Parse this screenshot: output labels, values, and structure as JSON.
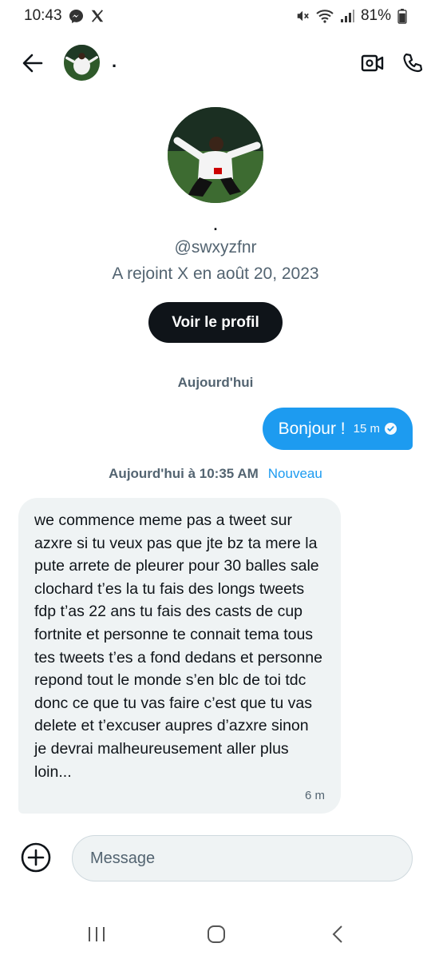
{
  "status_bar": {
    "time": "10:43",
    "battery": "81%"
  },
  "header": {
    "name": "."
  },
  "profile": {
    "name": ".",
    "handle": "@swxyzfnr",
    "joined": "A rejoint X en août 20, 2023",
    "view_button": "Voir le profil"
  },
  "conversation": {
    "day_label": "Aujourd'hui",
    "sent": {
      "text": "Bonjour !",
      "time": "15 m"
    },
    "new_divider": {
      "timestamp": "Aujourd'hui à 10:35 AM",
      "label": "Nouveau"
    },
    "received": {
      "text": "we commence meme pas a tweet sur azxre si tu veux pas que jte bz ta mere la pute arrete de pleurer pour 30 balles sale clochard t’es la tu fais des longs tweets fdp t’as 22 ans tu fais des casts de cup fortnite et personne te connait tema tous tes tweets t’es a fond dedans et personne repond tout le monde s’en blc de toi tdc donc ce que tu vas faire c’est que tu vas delete et t’excuser aupres d’azxre sinon je devrai malheureusement aller plus loin...",
      "time": "6 m"
    }
  },
  "composer": {
    "placeholder": "Message"
  },
  "icons": {
    "messenger": "messenger-icon",
    "x_logo": "x-logo-icon",
    "mute": "mute-icon",
    "wifi": "wifi-icon",
    "signal": "signal-icon",
    "battery": "battery-icon",
    "back": "back-arrow-icon",
    "video": "video-call-icon",
    "phone": "phone-icon",
    "add": "plus-circle-icon"
  },
  "colors": {
    "accent": "#1d9bf0",
    "received_bubble": "#eff3f4",
    "button_dark": "#0f1419",
    "secondary_text": "#536471"
  }
}
